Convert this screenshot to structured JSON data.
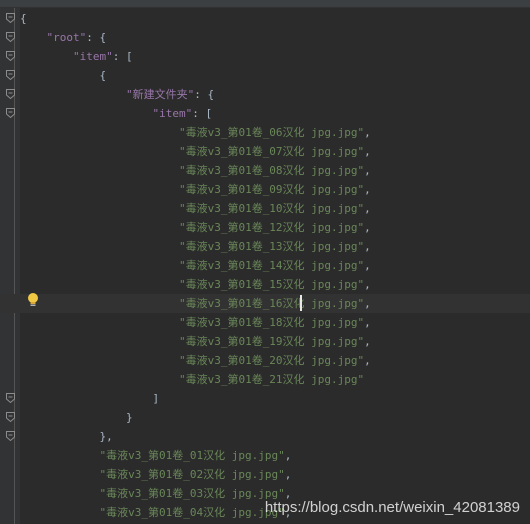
{
  "lines": [
    {
      "fold": true,
      "parts": [
        {
          "c": "p",
          "t": "{"
        }
      ]
    },
    {
      "fold": true,
      "parts": [
        {
          "c": "p",
          "t": "    "
        },
        {
          "c": "k",
          "t": "\"root\""
        },
        {
          "c": "p",
          "t": ": {"
        }
      ]
    },
    {
      "fold": true,
      "parts": [
        {
          "c": "p",
          "t": "        "
        },
        {
          "c": "k",
          "t": "\"item\""
        },
        {
          "c": "p",
          "t": ": ["
        }
      ]
    },
    {
      "fold": true,
      "parts": [
        {
          "c": "p",
          "t": "            {"
        }
      ]
    },
    {
      "fold": true,
      "parts": [
        {
          "c": "p",
          "t": "                "
        },
        {
          "c": "k",
          "t": "\"新建文件夹\""
        },
        {
          "c": "p",
          "t": ": {"
        }
      ]
    },
    {
      "fold": true,
      "parts": [
        {
          "c": "p",
          "t": "                    "
        },
        {
          "c": "k",
          "t": "\"item\""
        },
        {
          "c": "p",
          "t": ": ["
        }
      ]
    },
    {
      "fold": false,
      "parts": [
        {
          "c": "p",
          "t": "                        "
        },
        {
          "c": "s",
          "t": "\"毒液v3_第01卷_06汉化 jpg.jpg\""
        },
        {
          "c": "p",
          "t": ","
        }
      ]
    },
    {
      "fold": false,
      "parts": [
        {
          "c": "p",
          "t": "                        "
        },
        {
          "c": "s",
          "t": "\"毒液v3_第01卷_07汉化 jpg.jpg\""
        },
        {
          "c": "p",
          "t": ","
        }
      ]
    },
    {
      "fold": false,
      "parts": [
        {
          "c": "p",
          "t": "                        "
        },
        {
          "c": "s",
          "t": "\"毒液v3_第01卷_08汉化 jpg.jpg\""
        },
        {
          "c": "p",
          "t": ","
        }
      ]
    },
    {
      "fold": false,
      "parts": [
        {
          "c": "p",
          "t": "                        "
        },
        {
          "c": "s",
          "t": "\"毒液v3_第01卷_09汉化 jpg.jpg\""
        },
        {
          "c": "p",
          "t": ","
        }
      ]
    },
    {
      "fold": false,
      "parts": [
        {
          "c": "p",
          "t": "                        "
        },
        {
          "c": "s",
          "t": "\"毒液v3_第01卷_10汉化 jpg.jpg\""
        },
        {
          "c": "p",
          "t": ","
        }
      ]
    },
    {
      "fold": false,
      "parts": [
        {
          "c": "p",
          "t": "                        "
        },
        {
          "c": "s",
          "t": "\"毒液v3_第01卷_12汉化 jpg.jpg\""
        },
        {
          "c": "p",
          "t": ","
        }
      ]
    },
    {
      "fold": false,
      "parts": [
        {
          "c": "p",
          "t": "                        "
        },
        {
          "c": "s",
          "t": "\"毒液v3_第01卷_13汉化 jpg.jpg\""
        },
        {
          "c": "p",
          "t": ","
        }
      ]
    },
    {
      "fold": false,
      "parts": [
        {
          "c": "p",
          "t": "                        "
        },
        {
          "c": "s",
          "t": "\"毒液v3_第01卷_14汉化 jpg.jpg\""
        },
        {
          "c": "p",
          "t": ","
        }
      ]
    },
    {
      "fold": false,
      "parts": [
        {
          "c": "p",
          "t": "                        "
        },
        {
          "c": "s",
          "t": "\"毒液v3_第01卷_15汉化 jpg.jpg\""
        },
        {
          "c": "p",
          "t": ","
        }
      ]
    },
    {
      "fold": false,
      "parts": [
        {
          "c": "p",
          "t": "                        "
        },
        {
          "c": "s",
          "t": "\"毒液v3_第01卷_16汉化 jpg.jpg\""
        },
        {
          "c": "p",
          "t": ","
        }
      ]
    },
    {
      "fold": false,
      "parts": [
        {
          "c": "p",
          "t": "                        "
        },
        {
          "c": "s",
          "t": "\"毒液v3_第01卷_18汉化 jpg.jpg\""
        },
        {
          "c": "p",
          "t": ","
        }
      ]
    },
    {
      "fold": false,
      "parts": [
        {
          "c": "p",
          "t": "                        "
        },
        {
          "c": "s",
          "t": "\"毒液v3_第01卷_19汉化 jpg.jpg\""
        },
        {
          "c": "p",
          "t": ","
        }
      ]
    },
    {
      "fold": false,
      "parts": [
        {
          "c": "p",
          "t": "                        "
        },
        {
          "c": "s",
          "t": "\"毒液v3_第01卷_20汉化 jpg.jpg\""
        },
        {
          "c": "p",
          "t": ","
        }
      ]
    },
    {
      "fold": false,
      "parts": [
        {
          "c": "p",
          "t": "                        "
        },
        {
          "c": "s",
          "t": "\"毒液v3_第01卷_21汉化 jpg.jpg\""
        }
      ]
    },
    {
      "fold": true,
      "parts": [
        {
          "c": "p",
          "t": "                    ]"
        }
      ]
    },
    {
      "fold": true,
      "parts": [
        {
          "c": "p",
          "t": "                }"
        }
      ]
    },
    {
      "fold": true,
      "parts": [
        {
          "c": "p",
          "t": "            },"
        }
      ]
    },
    {
      "fold": false,
      "parts": [
        {
          "c": "p",
          "t": "            "
        },
        {
          "c": "s",
          "t": "\"毒液v3_第01卷_01汉化 jpg.jpg\""
        },
        {
          "c": "p",
          "t": ","
        }
      ]
    },
    {
      "fold": false,
      "parts": [
        {
          "c": "p",
          "t": "            "
        },
        {
          "c": "s",
          "t": "\"毒液v3_第01卷_02汉化 jpg.jpg\""
        },
        {
          "c": "p",
          "t": ","
        }
      ]
    },
    {
      "fold": false,
      "parts": [
        {
          "c": "p",
          "t": "            "
        },
        {
          "c": "s",
          "t": "\"毒液v3_第01卷_03汉化 jpg.jpg\""
        },
        {
          "c": "p",
          "t": ","
        }
      ]
    },
    {
      "fold": false,
      "parts": [
        {
          "c": "p",
          "t": "            "
        },
        {
          "c": "s",
          "t": "\"毒液v3_第01卷_04汉化 jpg.jpg\""
        },
        {
          "c": "p",
          "t": ","
        }
      ]
    }
  ],
  "caret_line": 15,
  "colors": {
    "background": "#2b2b2b",
    "punctuation": "#a9b7c6",
    "key": "#9876aa",
    "string": "#6a8759",
    "gutter": "#313335"
  },
  "icons": {
    "fold": "fold-marker-icon",
    "intention": "lightbulb-icon"
  },
  "watermark": "https://blog.csdn.net/weixin_42081389"
}
